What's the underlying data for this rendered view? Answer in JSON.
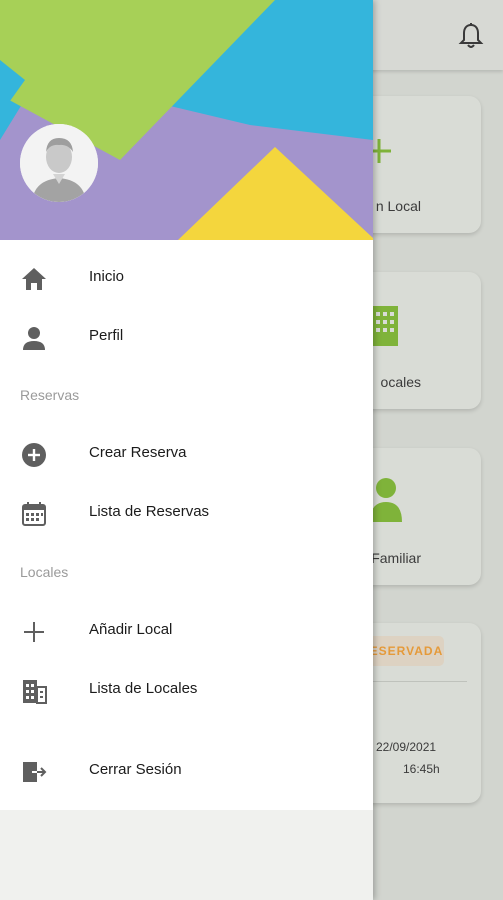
{
  "background": {
    "cards": [
      {
        "label": "n Local"
      },
      {
        "label": "ocales"
      },
      {
        "label": "Familiar"
      }
    ],
    "reservation": {
      "status": "RESERVADA",
      "date": "22/09/2021",
      "time": "16:45h"
    }
  },
  "drawer": {
    "items": [
      {
        "label": "Inicio",
        "icon": "home-icon"
      },
      {
        "label": "Perfil",
        "icon": "person-icon"
      },
      {
        "label": "Crear Reserva",
        "icon": "add-circle-icon"
      },
      {
        "label": "Lista de Reservas",
        "icon": "calendar-icon"
      },
      {
        "label": "Añadir Local",
        "icon": "plus-icon"
      },
      {
        "label": "Lista de Locales",
        "icon": "building-icon"
      },
      {
        "label": "Cerrar Sesión",
        "icon": "logout-icon"
      }
    ],
    "sections": {
      "reservas": "Reservas",
      "locales": "Locales"
    }
  },
  "colors": {
    "accent_green": "#8dc63f",
    "header_blue": "#34b5dc",
    "header_purple": "#a394cc",
    "header_yellow": "#f4d63d",
    "badge_text": "#e59a3a"
  }
}
